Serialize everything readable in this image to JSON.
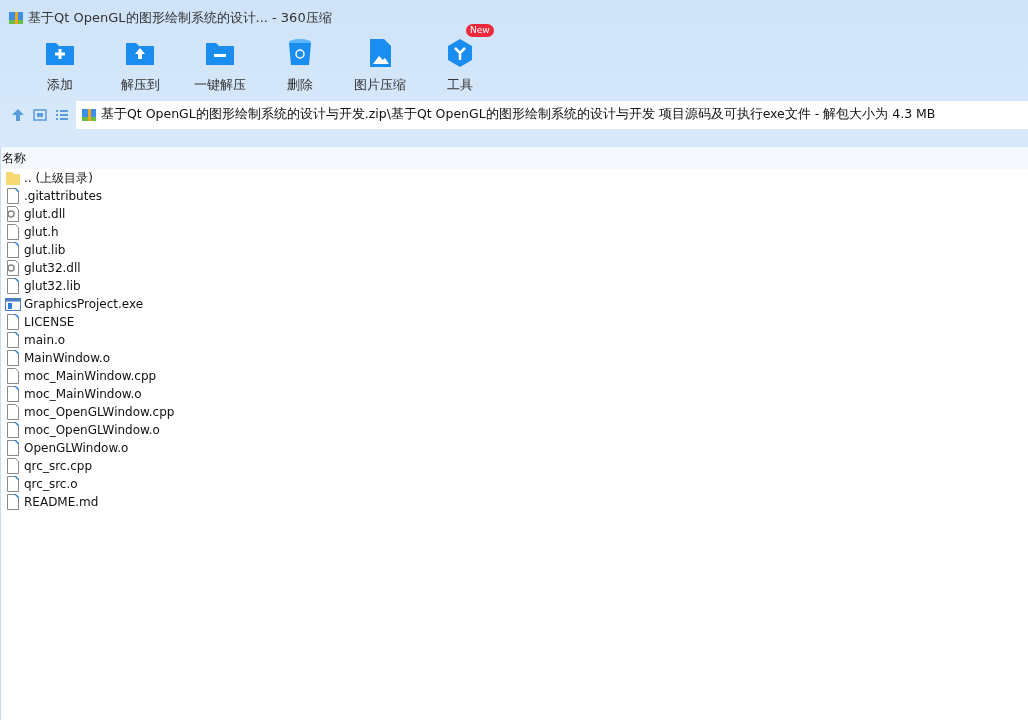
{
  "window": {
    "title": "基于Qt OpenGL的图形绘制系统的设计... - 360压缩"
  },
  "toolbar": [
    {
      "kind": "add",
      "label": "添加"
    },
    {
      "kind": "extract-to",
      "label": "解压到"
    },
    {
      "kind": "extract",
      "label": "一键解压"
    },
    {
      "kind": "delete",
      "label": "删除"
    },
    {
      "kind": "image",
      "label": "图片压缩"
    },
    {
      "kind": "tools",
      "label": "工具",
      "badge": "New"
    }
  ],
  "address": {
    "path": "基于Qt OpenGL的图形绘制系统的设计与开发.zip\\基于Qt OpenGL的图形绘制系统的设计与开发 项目源码及可执行exe文件 - 解包大小为 4.3 MB"
  },
  "table": {
    "columns": [
      "名称"
    ],
    "rows": [
      {
        "kind": "folder",
        "name": ".. (上级目录)"
      },
      {
        "kind": "typed",
        "name": ".gitattributes"
      },
      {
        "kind": "dll",
        "name": "glut.dll"
      },
      {
        "kind": "plain",
        "name": "glut.h"
      },
      {
        "kind": "typed",
        "name": "glut.lib"
      },
      {
        "kind": "dll",
        "name": "glut32.dll"
      },
      {
        "kind": "typed",
        "name": "glut32.lib"
      },
      {
        "kind": "exe",
        "name": "GraphicsProject.exe"
      },
      {
        "kind": "typed",
        "name": "LICENSE"
      },
      {
        "kind": "typed",
        "name": "main.o"
      },
      {
        "kind": "typed",
        "name": "MainWindow.o"
      },
      {
        "kind": "plain",
        "name": "moc_MainWindow.cpp"
      },
      {
        "kind": "typed",
        "name": "moc_MainWindow.o"
      },
      {
        "kind": "plain",
        "name": "moc_OpenGLWindow.cpp"
      },
      {
        "kind": "typed",
        "name": "moc_OpenGLWindow.o"
      },
      {
        "kind": "typed",
        "name": "OpenGLWindow.o"
      },
      {
        "kind": "plain",
        "name": "qrc_src.cpp"
      },
      {
        "kind": "typed",
        "name": "qrc_src.o"
      },
      {
        "kind": "typed",
        "name": "README.md"
      }
    ]
  }
}
